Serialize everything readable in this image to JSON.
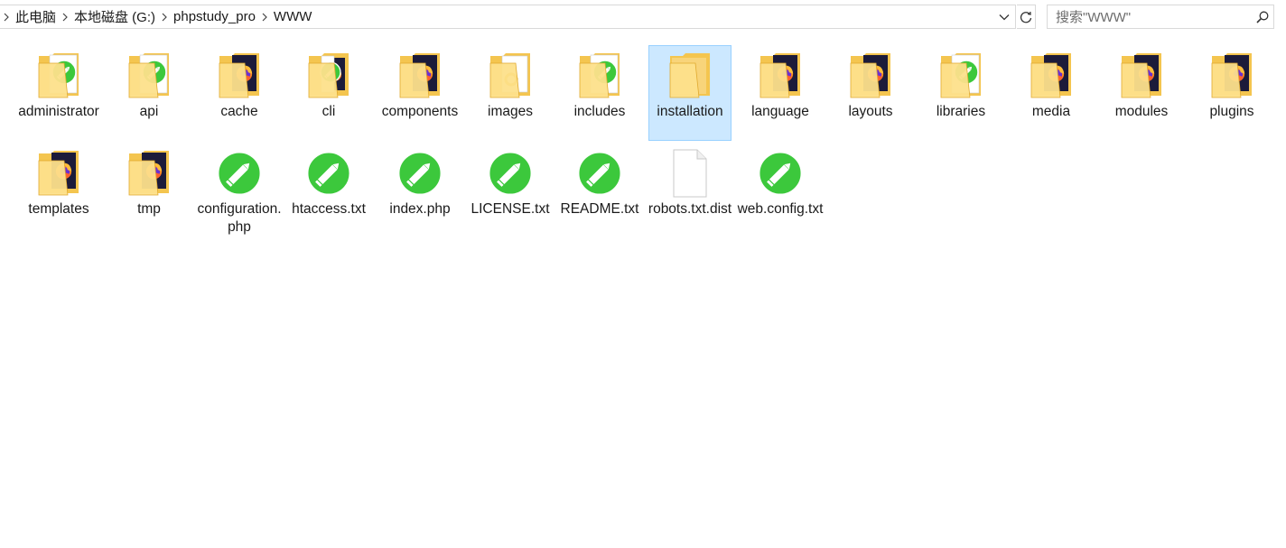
{
  "breadcrumb": [
    "此电脑",
    "本地磁盘 (G:)",
    "phpstudy_pro",
    "WWW"
  ],
  "search": {
    "placeholder": "搜索\"WWW\""
  },
  "items": [
    {
      "label": "administrator",
      "kind": "folder-pencil"
    },
    {
      "label": "api",
      "kind": "folder-pencil"
    },
    {
      "label": "cache",
      "kind": "folder-firefox"
    },
    {
      "label": "cli",
      "kind": "folder-firefox-partial"
    },
    {
      "label": "components",
      "kind": "folder-firefox"
    },
    {
      "label": "images",
      "kind": "folder-image"
    },
    {
      "label": "includes",
      "kind": "folder-pencil"
    },
    {
      "label": "installation",
      "kind": "folder-plain"
    },
    {
      "label": "language",
      "kind": "folder-firefox"
    },
    {
      "label": "layouts",
      "kind": "folder-firefox"
    },
    {
      "label": "libraries",
      "kind": "folder-pencil"
    },
    {
      "label": "media",
      "kind": "folder-firefox"
    },
    {
      "label": "modules",
      "kind": "folder-firefox"
    },
    {
      "label": "plugins",
      "kind": "folder-firefox"
    },
    {
      "label": "templates",
      "kind": "folder-firefox"
    },
    {
      "label": "tmp",
      "kind": "folder-firefox"
    },
    {
      "label": "configuration.php",
      "kind": "file-pencil"
    },
    {
      "label": "htaccess.txt",
      "kind": "file-pencil"
    },
    {
      "label": "index.php",
      "kind": "file-pencil"
    },
    {
      "label": "LICENSE.txt",
      "kind": "file-pencil"
    },
    {
      "label": "README.txt",
      "kind": "file-pencil"
    },
    {
      "label": "robots.txt.dist",
      "kind": "file-blank"
    },
    {
      "label": "web.config.txt",
      "kind": "file-pencil"
    }
  ],
  "selected_item": "installation",
  "colors": {
    "folder": "#f4c54f",
    "folder_light": "#fde08b",
    "pencil_green": "#3cc83c",
    "selection_bg": "#cce8ff",
    "selection_border": "#99d1ff"
  }
}
